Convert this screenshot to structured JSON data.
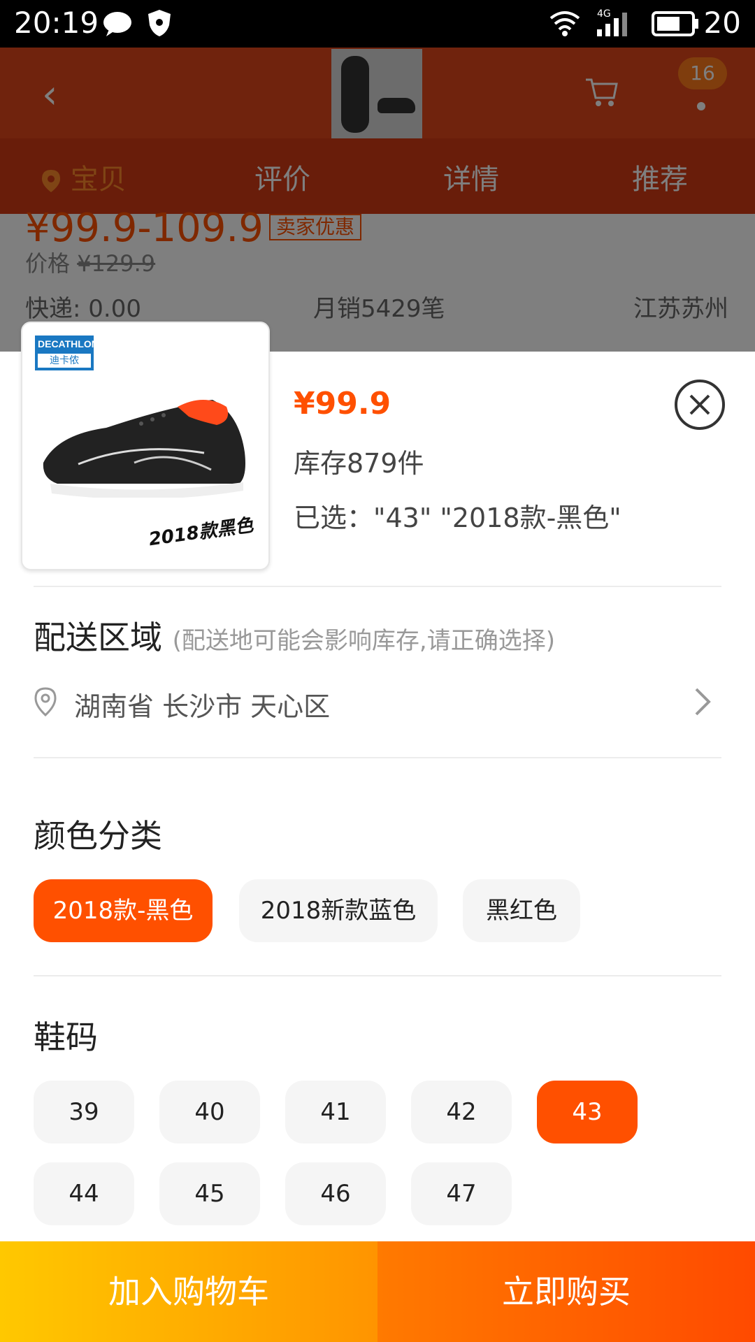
{
  "status_bar": {
    "time": "20:19",
    "battery": "20",
    "network": "4G"
  },
  "background_page": {
    "cart_badge": "16",
    "tabs": [
      "宝贝",
      "评价",
      "详情",
      "推荐"
    ],
    "price_range": "¥99.9-109.9",
    "promo_tag": "卖家优惠",
    "original_price_label": "价格",
    "original_price": "¥129.9",
    "shipping_stub": "快递: 0.00",
    "monthly_sales": "月销5429笔",
    "location": "江苏苏州"
  },
  "product": {
    "brand_line1": "DECATHLON",
    "brand_line2": "迪卡侬",
    "image_caption": "2018款黑色",
    "price": "¥99.9",
    "stock": "库存879件",
    "selected": "已选：\"43\" \"2018款-黑色\""
  },
  "delivery": {
    "title": "配送区域",
    "hint": "(配送地可能会影响库存,请正确选择)",
    "address": "湖南省 长沙市 天心区"
  },
  "color": {
    "title": "颜色分类",
    "options": [
      "2018款-黑色",
      "2018新款蓝色",
      "黑红色"
    ],
    "selected": "2018款-黑色"
  },
  "size": {
    "title": "鞋码",
    "options": [
      "39",
      "40",
      "41",
      "42",
      "43",
      "44",
      "45",
      "46",
      "47"
    ],
    "selected": "43"
  },
  "actions": {
    "add_to_cart": "加入购物车",
    "buy_now": "立即购买"
  },
  "colors": {
    "accent": "#ff5000",
    "cart_btn_start": "#ffc800",
    "cart_btn_end": "#ff9400",
    "buy_btn_start": "#ff7a00",
    "buy_btn_end": "#ff4a00"
  }
}
